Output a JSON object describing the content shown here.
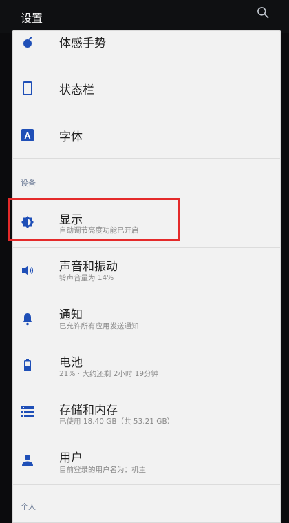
{
  "header": {
    "title": "设置"
  },
  "items_top": [
    {
      "label": "体感手势",
      "icon": "gesture-icon"
    },
    {
      "label": "状态栏",
      "icon": "status-bar-icon"
    },
    {
      "label": "字体",
      "icon": "font-icon"
    }
  ],
  "sections": {
    "device": "设备",
    "personal": "个人"
  },
  "device_items": [
    {
      "label": "显示",
      "subtitle": "自动调节亮度功能已开启",
      "icon": "brightness-icon"
    },
    {
      "label": "声音和振动",
      "subtitle": "铃声音量为 14%",
      "icon": "volume-icon"
    },
    {
      "label": "通知",
      "subtitle": "已允许所有应用发送通知",
      "icon": "bell-icon"
    },
    {
      "label": "电池",
      "subtitle": "21% · 大约还剩 2小时 19分钟",
      "icon": "battery-icon"
    },
    {
      "label": "存储和内存",
      "subtitle": "已使用 18.40 GB（共 53.21 GB）",
      "icon": "storage-icon"
    },
    {
      "label": "用户",
      "subtitle": "目前登录的用户名为：机主",
      "icon": "user-icon"
    }
  ],
  "colors": {
    "accent": "#1f4fb7",
    "highlight": "#e42a2a",
    "background": "#f2f2f2"
  }
}
